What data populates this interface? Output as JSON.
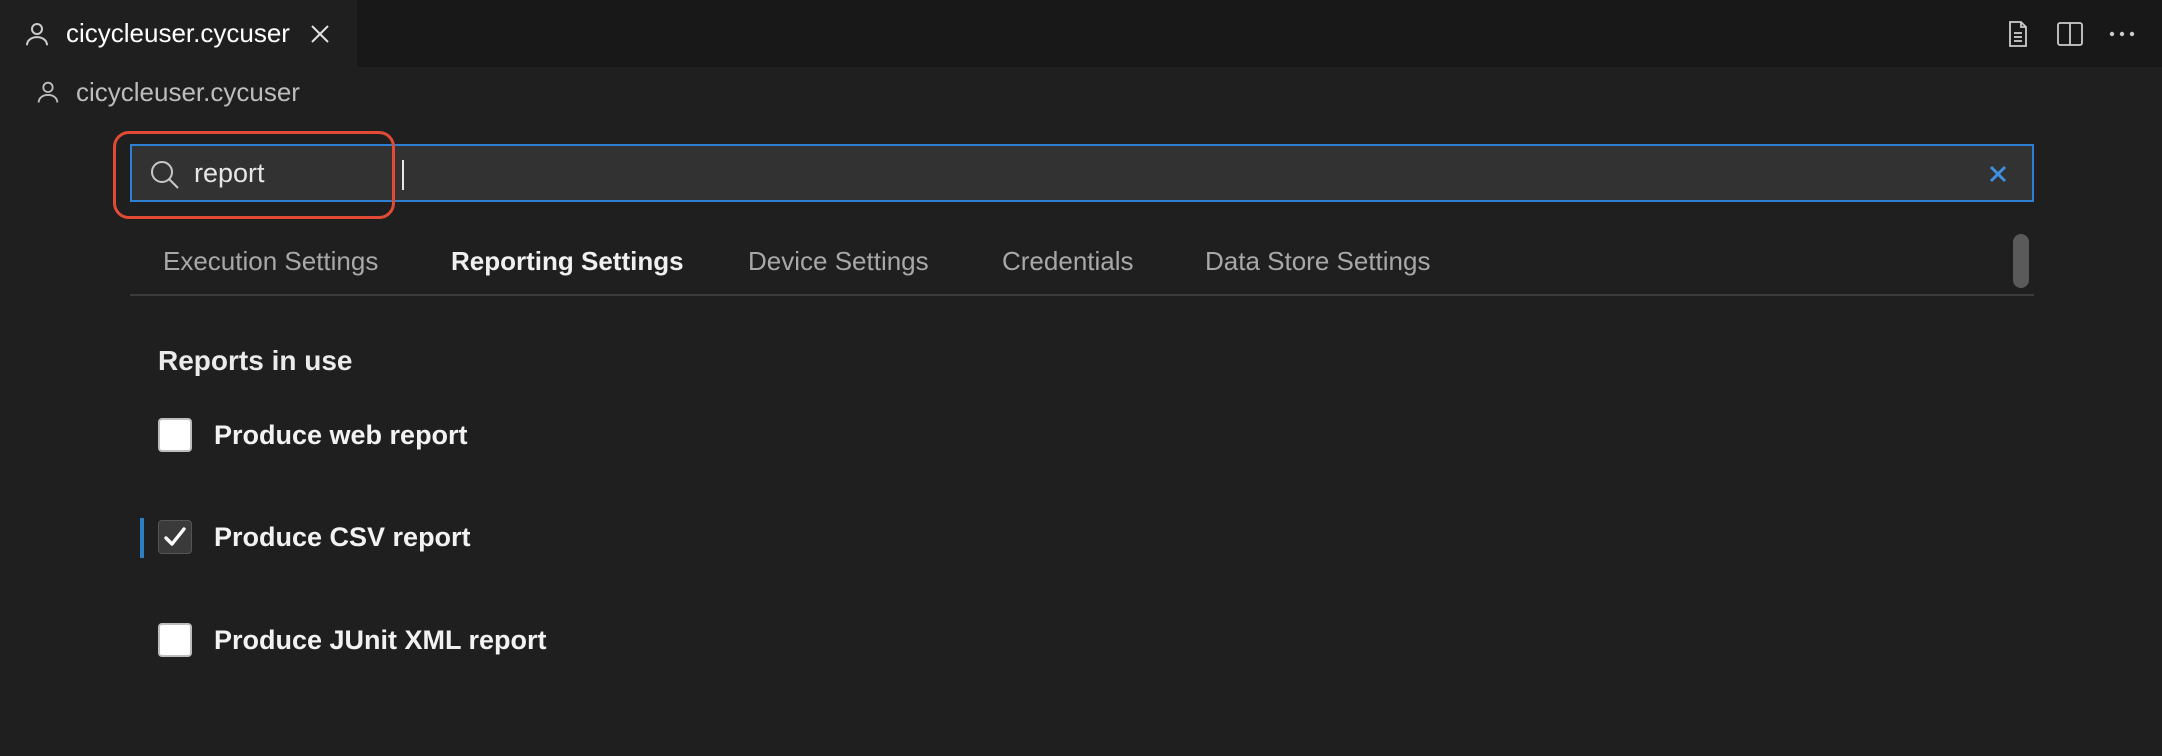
{
  "tab": {
    "title": "cicycleuser.cycuser",
    "icon": "person-icon",
    "close_icon": "close-icon"
  },
  "actions": {
    "icons": [
      "open-json-icon",
      "split-editor-icon",
      "more-actions-icon"
    ]
  },
  "breadcrumb": {
    "label": "cicycleuser.cycuser",
    "icon": "person-icon"
  },
  "search": {
    "value": "report",
    "placeholder": ""
  },
  "settings_tabs": [
    {
      "label": "Execution Settings",
      "active": false
    },
    {
      "label": "Reporting Settings",
      "active": true
    },
    {
      "label": "Device Settings",
      "active": false
    },
    {
      "label": "Credentials",
      "active": false
    },
    {
      "label": "Data Store Settings",
      "active": false
    }
  ],
  "section": {
    "title": "Reports in use",
    "items": [
      {
        "label": "Produce web report",
        "checked": false,
        "modified": false
      },
      {
        "label": "Produce CSV report",
        "checked": true,
        "modified": true
      },
      {
        "label": "Produce JUnit XML report",
        "checked": false,
        "modified": false
      }
    ]
  },
  "colors": {
    "background": "#1f1f1f",
    "tabbar": "#181818",
    "focus_border": "#2d7fd1",
    "annotation": "#e14b35",
    "modified_indicator": "#2e7fc0"
  }
}
